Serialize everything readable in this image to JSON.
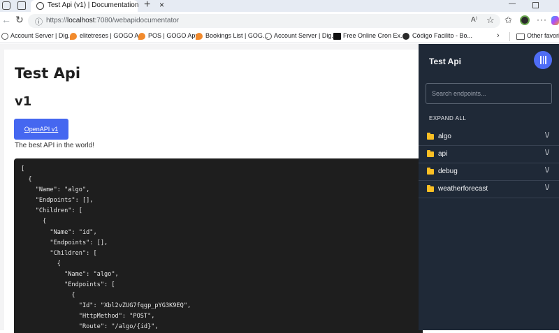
{
  "browser": {
    "tab_title": "Test Api (v1) | Documentation",
    "url_prefix": "https://",
    "url_host": "localhost",
    "url_rest": ":7080/webapidocumentator",
    "read_aloud": "A⁾",
    "bookmarks": [
      {
        "label": "Account Server | Dig...",
        "icon": "globe-icon"
      },
      {
        "label": "elitetreses | GOGO A...",
        "icon": "orange-icon"
      },
      {
        "label": "POS | GOGO App",
        "icon": "orange-icon"
      },
      {
        "label": "Bookings List | GOG...",
        "icon": "orange-icon"
      },
      {
        "label": "Account Server | Dig...",
        "icon": "globe-icon"
      },
      {
        "label": "Free Online Cron Ex...",
        "icon": "ff-icon"
      },
      {
        "label": "Código Facilito - Bo...",
        "icon": "cf-icon"
      }
    ],
    "other_favorites": "Other favorite"
  },
  "doc": {
    "title": "Test Api",
    "version": "v1",
    "openapi_button": "OpenAPI v1",
    "description": "The best API in the world!",
    "code_lines": [
      "[",
      "  {",
      "    \"Name\": \"algo\",",
      "    \"Endpoints\": [],",
      "    \"Children\": [",
      "      {",
      "        \"Name\": \"id\",",
      "        \"Endpoints\": [],",
      "        \"Children\": [",
      "          {",
      "            \"Name\": \"algo\",",
      "            \"Endpoints\": [",
      "              {",
      "                \"Id\": \"Xbl2vZUG7fqgp_pYG3K9EQ\",",
      "                \"HttpMethod\": \"POST\",",
      "                \"Route\": \"/algo/{id}\","
    ]
  },
  "sidebar": {
    "title": "Test Api",
    "search_placeholder": "Search endpoints...",
    "expand_all": "EXPAND ALL",
    "items": [
      {
        "label": "algo"
      },
      {
        "label": "api"
      },
      {
        "label": "debug"
      },
      {
        "label": "weatherforecast"
      }
    ],
    "chevron": "\\/",
    "folder_color": "#fbbf24",
    "accent_color": "#4f6df5"
  }
}
